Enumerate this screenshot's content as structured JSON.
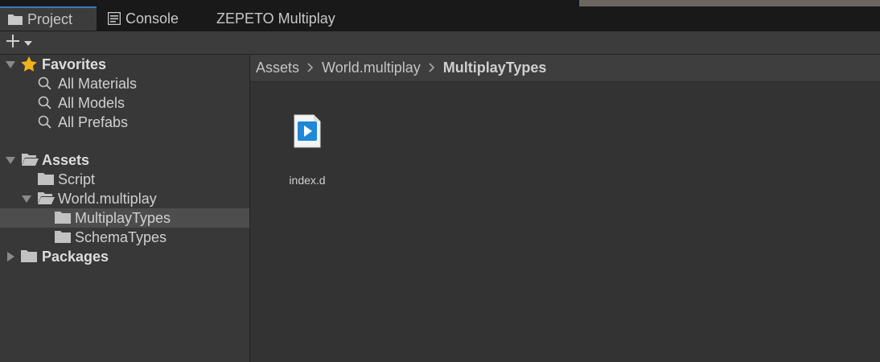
{
  "tabs": [
    {
      "label": "Project",
      "icon": "folder-icon",
      "active": true
    },
    {
      "label": "Console",
      "icon": "console-icon",
      "active": false
    },
    {
      "label": "ZEPETO Multiplay",
      "active": false
    }
  ],
  "toolbar": {
    "create_button": "+"
  },
  "tree": {
    "favorites": {
      "label": "Favorites",
      "items": [
        "All Materials",
        "All Models",
        "All Prefabs"
      ]
    },
    "assets": {
      "label": "Assets",
      "children": [
        {
          "label": "Script"
        },
        {
          "label": "World.multiplay",
          "children": [
            "MultiplayTypes",
            "SchemaTypes"
          ]
        }
      ]
    },
    "packages": {
      "label": "Packages"
    },
    "selected": "MultiplayTypes"
  },
  "breadcrumb": [
    "Assets",
    "World.multiplay",
    "MultiplayTypes"
  ],
  "files": [
    {
      "name": "index.d",
      "icon": "script-file-icon"
    }
  ],
  "colors": {
    "accent": "#3a79bb",
    "star": "#f0b418",
    "folder": "#c2c2c2",
    "file_blue": "#1f88d8"
  }
}
